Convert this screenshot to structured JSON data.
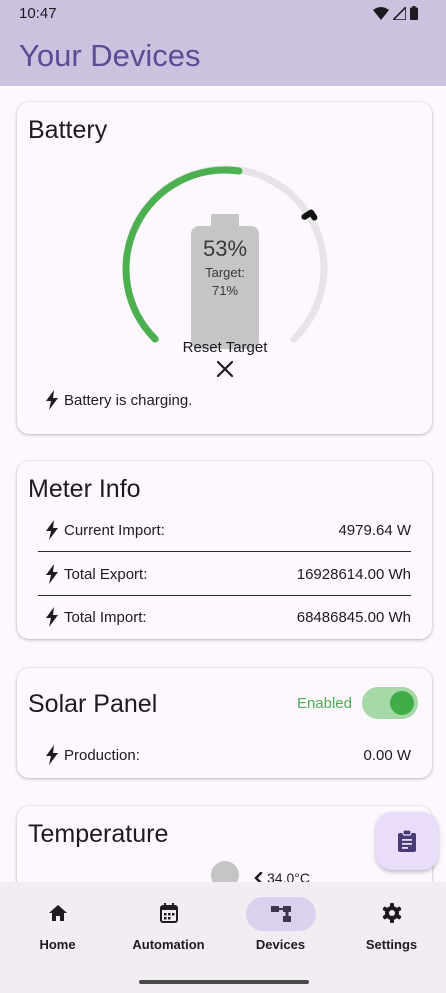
{
  "status_bar": {
    "time": "10:47",
    "icons": [
      "wifi-icon",
      "signal-icon",
      "battery-icon"
    ]
  },
  "app_bar": {
    "title": "Your Devices"
  },
  "battery_card": {
    "title": "Battery",
    "level_text": "53%",
    "target_label": "Target:",
    "target_value": "71%",
    "level_fraction": 0.53,
    "target_fraction": 0.71,
    "reset_label": "Reset Target",
    "status_text": "Battery is charging."
  },
  "meter_card": {
    "title": "Meter Info",
    "rows": [
      {
        "label": "Current Import:",
        "value": "4979.64 W"
      },
      {
        "label": "Total Export:",
        "value": "16928614.00 Wh"
      },
      {
        "label": "Total Import:",
        "value": "68486845.00 Wh"
      }
    ]
  },
  "solar_card": {
    "title": "Solar Panel",
    "toggle_label": "Enabled",
    "enabled": true,
    "rows": [
      {
        "label": "Production:",
        "value": "0.00 W"
      }
    ]
  },
  "temperature_card": {
    "title": "Temperature",
    "value": "34.0°C"
  },
  "bottom_nav": {
    "items": [
      {
        "label": "Home",
        "icon": "home-icon"
      },
      {
        "label": "Automation",
        "icon": "calendar-icon"
      },
      {
        "label": "Devices",
        "icon": "devices-icon",
        "selected": true
      },
      {
        "label": "Settings",
        "icon": "gear-icon"
      }
    ]
  },
  "colors": {
    "accent": "#5c4b95",
    "app_bar": "#cdc1e0",
    "success": "#41ad49",
    "fab": "#e9ddfb"
  }
}
